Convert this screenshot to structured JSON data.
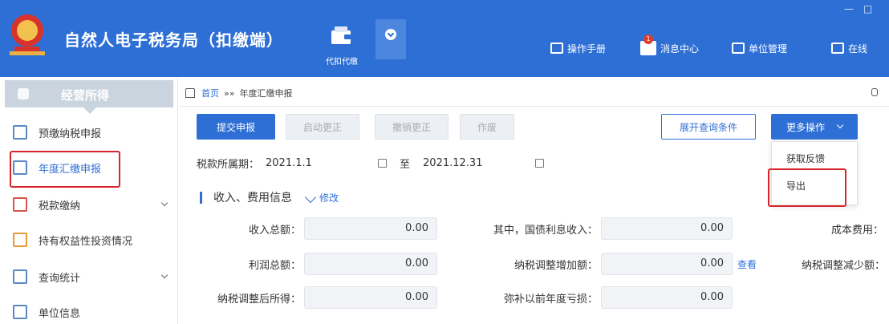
{
  "header": {
    "title": "自然人电子税务局（扣缴端）",
    "tab_label": "代扣代缴",
    "tab_icon": "wallet-icon",
    "tools": [
      {
        "label": "操作手册",
        "icon": "manual-icon"
      },
      {
        "label": "消息中心",
        "icon": "message-icon",
        "badge": "1"
      },
      {
        "label": "单位管理",
        "icon": "unit-icon"
      },
      {
        "label": "在线",
        "icon": "chat-icon"
      }
    ],
    "minimize": "—",
    "maximize": "□",
    "brand_color": "#2e6fd6"
  },
  "sidebar": {
    "header": "经营所得",
    "items": [
      {
        "label": "预缴纳税申报",
        "icon": "declare-icon"
      },
      {
        "label": "年度汇缴申报",
        "icon": "annual-icon"
      },
      {
        "label": "税款缴纳",
        "icon": "payment-icon"
      },
      {
        "label": "持有权益性投资情况",
        "icon": "investment-icon"
      },
      {
        "label": "查询统计",
        "icon": "statistics-icon"
      },
      {
        "label": "单位信息",
        "icon": "unit-info-icon"
      }
    ]
  },
  "breadcrumb": {
    "home": "首页",
    "separator": "»»",
    "current": "年度汇缴申报"
  },
  "toolbar": {
    "submit": "提交申报",
    "auto_correct": "启动更正",
    "cancel_correct": "撤销更正",
    "void": "作废",
    "expand_query": "展开查询条件",
    "more": "更多操作"
  },
  "more_menu": {
    "items": [
      "获取反馈",
      "导出"
    ]
  },
  "period": {
    "label": "税款所属期：",
    "start": "2021.1.1",
    "to": "至",
    "end": "2021.12.31"
  },
  "section": {
    "title": "收入、费用信息",
    "edit": "修改"
  },
  "form": {
    "income_total_label": "收入总额：",
    "income_total": "0.00",
    "bond_interest_label": "其中，国债利息收入：",
    "bond_interest": "0.00",
    "cost_label": "成本费用：",
    "profit_total_label": "利润总额：",
    "profit_total": "0.00",
    "tax_increase_label": "纳税调整增加额：",
    "tax_increase": "0.00",
    "view_link": "查看",
    "tax_decrease_label": "纳税调整减少额：",
    "adjusted_income_label": "纳税调整后所得：",
    "adjusted_income": "0.00",
    "loss_offset_label": "弥补以前年度亏损：",
    "loss_offset": "0.00"
  }
}
